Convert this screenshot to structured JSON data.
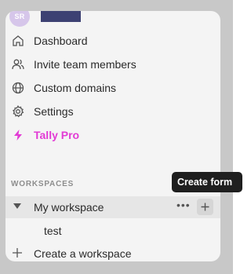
{
  "header": {
    "avatar_initials": "SR"
  },
  "nav": {
    "items": [
      {
        "label": "Dashboard",
        "icon": "home-icon"
      },
      {
        "label": "Invite team members",
        "icon": "users-icon"
      },
      {
        "label": "Custom domains",
        "icon": "globe-icon"
      },
      {
        "label": "Settings",
        "icon": "gear-icon"
      },
      {
        "label": "Tally Pro",
        "icon": "lightning-icon"
      }
    ]
  },
  "workspaces": {
    "section_label": "WORKSPACES",
    "current": "My workspace",
    "forms": [
      "test"
    ],
    "create_label": "Create a workspace"
  },
  "tooltip": {
    "text": "Create form"
  },
  "colors": {
    "pro_accent": "#e23bd5",
    "avatar_bg": "#d6c6ea",
    "tooltip_bg": "#1f1f1f"
  }
}
